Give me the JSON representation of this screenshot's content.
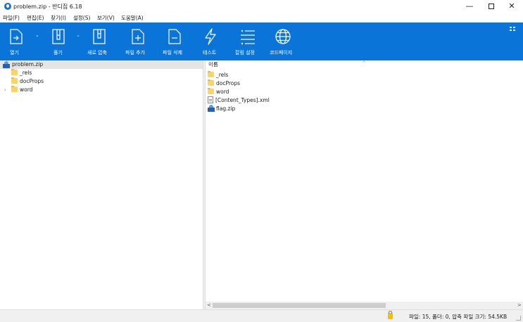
{
  "window": {
    "title": "problem.zip - 반디집 6.18",
    "minimize": "—",
    "close": "✕"
  },
  "menu": [
    "파일(F)",
    "편집(E)",
    "찾기(I)",
    "설정(S)",
    "보기(V)",
    "도움말(A)"
  ],
  "toolbar": {
    "open": "열기",
    "extract": "풀기",
    "new_archive": "새로 압축",
    "add_file": "파일 추가",
    "delete_file": "파일 삭제",
    "test": "테스트",
    "column_settings": "칼럼 설정",
    "codepage": "코드페이지",
    "dropdown_glyph": "⌄"
  },
  "tree": {
    "root": "problem.zip",
    "items": [
      {
        "label": "_rels",
        "expandable": false
      },
      {
        "label": "docProps",
        "expandable": false
      },
      {
        "label": "word",
        "expandable": true
      }
    ],
    "expander_glyph": "›"
  },
  "filelist": {
    "column_name": "이름",
    "sort_glyph": "^",
    "items": [
      {
        "label": "_rels",
        "icon": "folder-icon"
      },
      {
        "label": "docProps",
        "icon": "folder-icon"
      },
      {
        "label": "word",
        "icon": "folder-icon"
      },
      {
        "label": "[Content_Types].xml",
        "icon": "xml-file-icon"
      },
      {
        "label": "flag.zip",
        "icon": "zip-file-icon"
      }
    ],
    "scroll_left": "<",
    "scroll_right": ">"
  },
  "status": {
    "text": "파일: 15, 폴더: 0, 압축 파일 크기: 54.5KB"
  },
  "colors": {
    "toolbar_bg": "#0a74d8",
    "selection_bg": "#e5e5e5",
    "folder": "#f9d46c"
  }
}
